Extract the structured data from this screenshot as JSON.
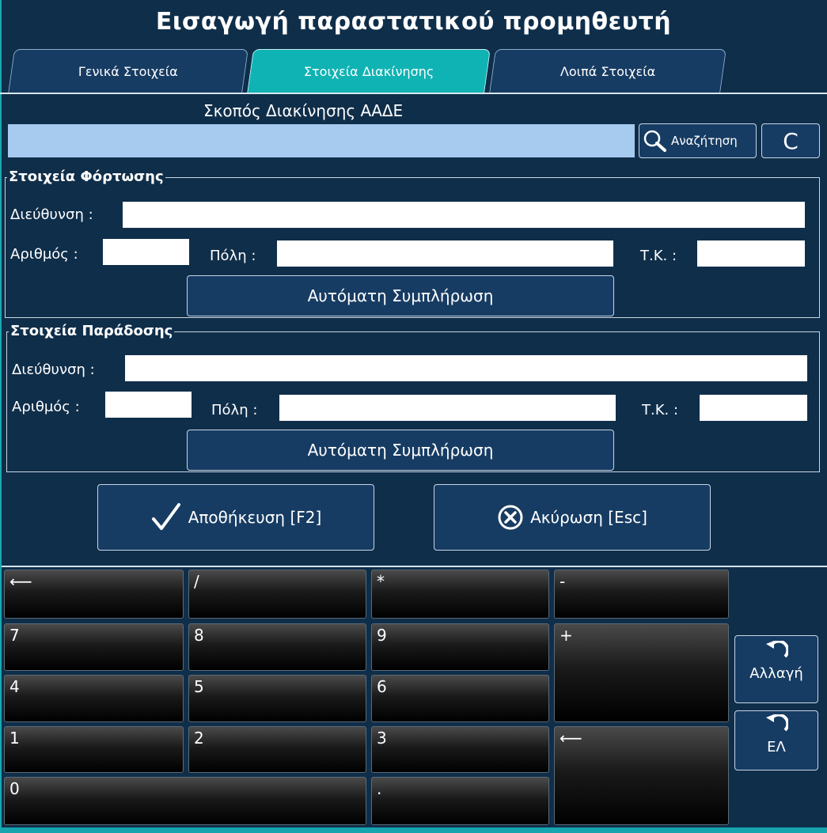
{
  "title": "Εισαγωγή παραστατικού προμηθευτή",
  "tabs": [
    {
      "label": "Γενικά Στοιχεία",
      "active": false
    },
    {
      "label": "Στοιχεία Διακίνησης",
      "active": true
    },
    {
      "label": "Λοιπά Στοιχεία",
      "active": false
    }
  ],
  "purpose": {
    "heading": "Σκοπός Διακίνησης ΑΑΔΕ",
    "value": "",
    "search_label": "Αναζήτηση",
    "clear_label": "C"
  },
  "loading": {
    "legend": "Στοιχεία Φόρτωσης",
    "address_label": "Διεύθυνση :",
    "number_label": "Αριθμός :",
    "city_label": "Πόλη :",
    "zip_label": "Τ.Κ. :",
    "address": "",
    "number": "",
    "city": "",
    "zip": "",
    "autofill_label": "Αυτόματη Συμπλήρωση"
  },
  "delivery": {
    "legend": "Στοιχεία Παράδοσης",
    "address_label": "Διεύθυνση :",
    "number_label": "Αριθμός :",
    "city_label": "Πόλη :",
    "zip_label": "Τ.Κ. :",
    "address": "",
    "number": "",
    "city": "",
    "zip": "",
    "autofill_label": "Αυτόματη Συμπλήρωση"
  },
  "actions": {
    "save_label": "Αποθήκευση [F2]",
    "cancel_label": "Ακύρωση [Esc]"
  },
  "keypad": {
    "backspace": "⟵",
    "divide": "/",
    "multiply": "*",
    "minus": "-",
    "k7": "7",
    "k8": "8",
    "k9": "9",
    "plus": "+",
    "k4": "4",
    "k5": "5",
    "k6": "6",
    "k1": "1",
    "k2": "2",
    "k3": "3",
    "enter": "⟵",
    "k0": "0",
    "dot": ".",
    "change_label": "Αλλαγή",
    "lang_label": "ΕΛ"
  },
  "colors": {
    "background": "#0f2e4a",
    "active_tab": "#10b3b4",
    "input_highlight": "#a6cbef",
    "button": "#173c63"
  }
}
